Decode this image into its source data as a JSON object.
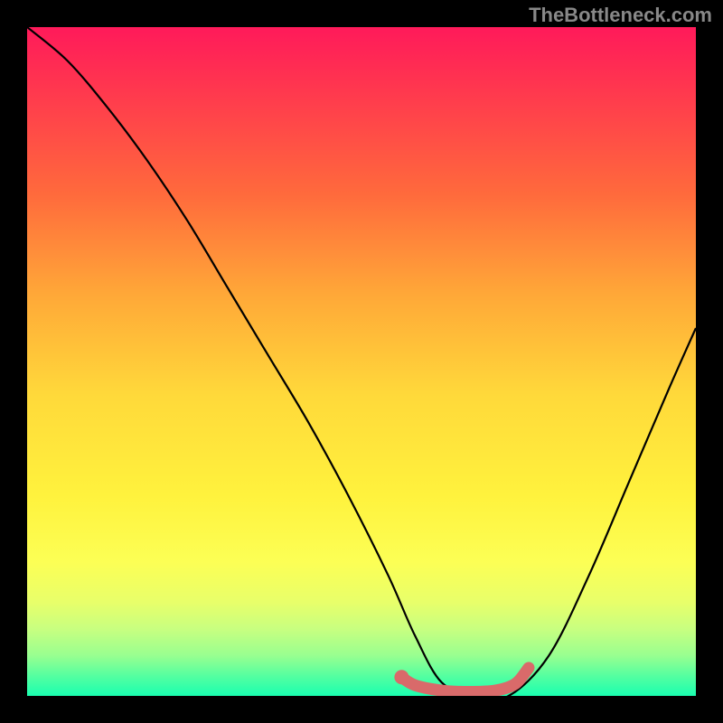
{
  "watermark": "TheBottleneck.com",
  "chart_data": {
    "type": "line",
    "title": "",
    "xlabel": "",
    "ylabel": "",
    "xlim": [
      0,
      100
    ],
    "ylim": [
      0,
      100
    ],
    "series": [
      {
        "name": "bottleneck-curve",
        "x": [
          0,
          6,
          12,
          18,
          24,
          30,
          36,
          42,
          48,
          54,
          58,
          62,
          67,
          72,
          78,
          84,
          90,
          96,
          100
        ],
        "y": [
          100,
          95,
          88,
          80,
          71,
          61,
          51,
          41,
          30,
          18,
          9,
          2,
          0,
          0,
          6,
          18,
          32,
          46,
          55
        ]
      },
      {
        "name": "optimal-marker",
        "x": [
          56,
          58,
          62,
          66,
          70,
          73,
          75
        ],
        "y": [
          2.8,
          1.6,
          0.8,
          0.6,
          0.8,
          1.8,
          4.2
        ]
      }
    ],
    "colors": {
      "curve": "#000000",
      "marker": "#d96a6a",
      "gradient_top": "#ff1a5a",
      "gradient_bottom": "#1affb0"
    }
  }
}
